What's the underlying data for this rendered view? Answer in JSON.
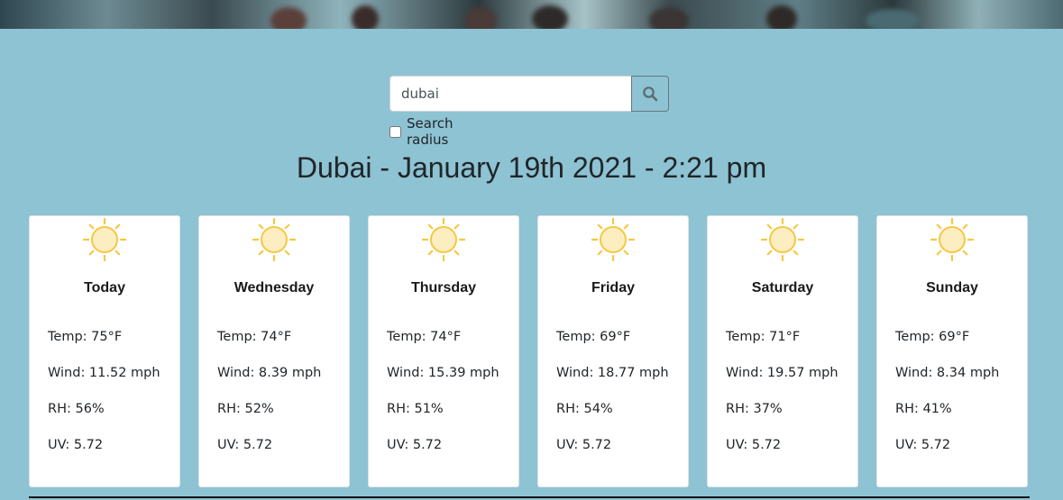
{
  "search": {
    "value": "dubai",
    "radius_label": "Search radius",
    "radius_checked": false
  },
  "heading": "Dubai - January 19th 2021 - 2:21 pm",
  "forecast": [
    {
      "day": "Today",
      "temp": "Temp: 75°F",
      "wind": "Wind: 11.52 mph",
      "rh": "RH: 56%",
      "uv": "UV: 5.72",
      "icon": "sun-icon"
    },
    {
      "day": "Wednesday",
      "temp": "Temp: 74°F",
      "wind": "Wind: 8.39 mph",
      "rh": "RH: 52%",
      "uv": "UV: 5.72",
      "icon": "sun-icon"
    },
    {
      "day": "Thursday",
      "temp": "Temp: 74°F",
      "wind": "Wind: 15.39 mph",
      "rh": "RH: 51%",
      "uv": "UV: 5.72",
      "icon": "sun-icon"
    },
    {
      "day": "Friday",
      "temp": "Temp: 69°F",
      "wind": "Wind: 18.77 mph",
      "rh": "RH: 54%",
      "uv": "UV: 5.72",
      "icon": "sun-icon"
    },
    {
      "day": "Saturday",
      "temp": "Temp: 71°F",
      "wind": "Wind: 19.57 mph",
      "rh": "RH: 37%",
      "uv": "UV: 5.72",
      "icon": "sun-icon"
    },
    {
      "day": "Sunday",
      "temp": "Temp: 69°F",
      "wind": "Wind: 8.34 mph",
      "rh": "RH: 41%",
      "uv": "UV: 5.72",
      "icon": "sun-icon"
    }
  ],
  "colors": {
    "page_background": "#8dc3d3",
    "card_background": "#ffffff",
    "sun_fill": "#fdeec2",
    "sun_stroke": "#f5c842"
  }
}
